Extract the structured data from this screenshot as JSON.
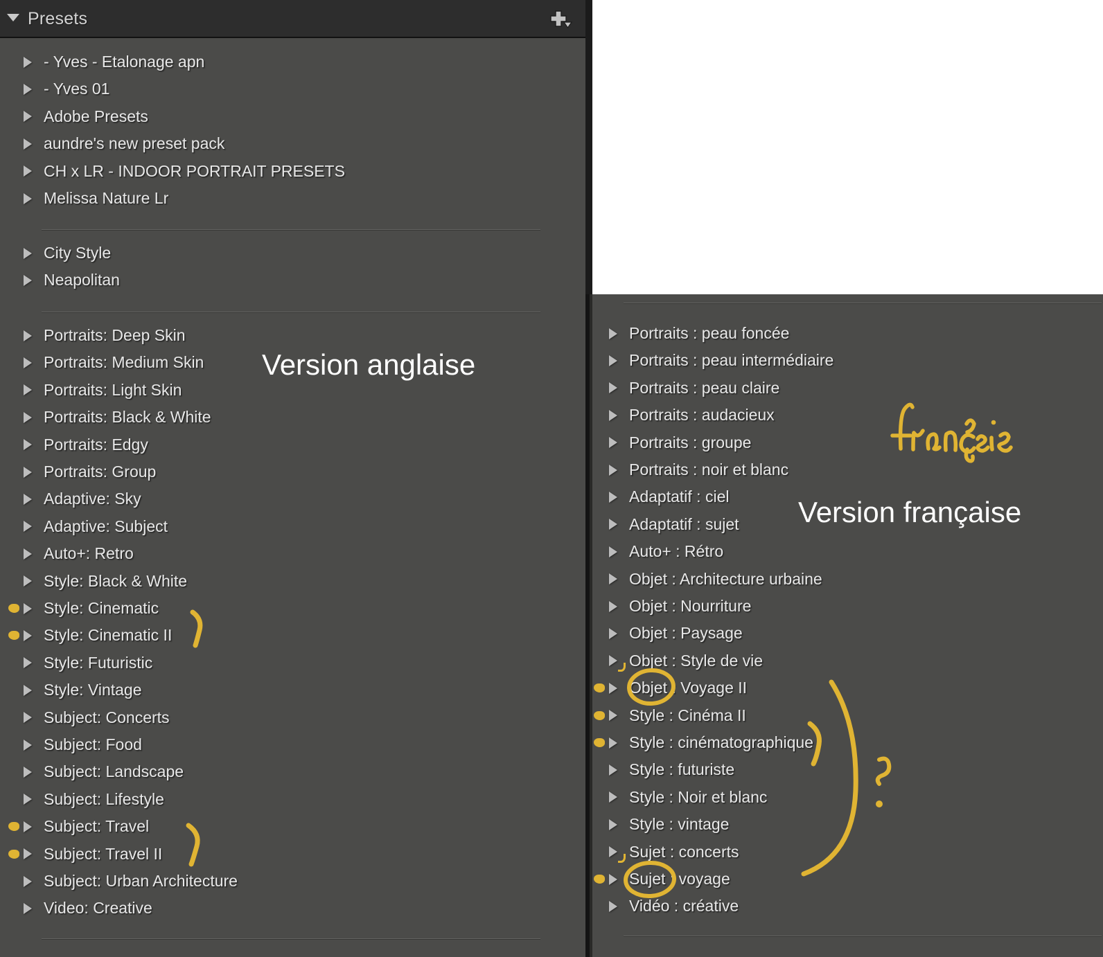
{
  "header": {
    "title": "Presets",
    "collapse_icon": "triangle-down-icon",
    "add_icon": "plus-with-chevron-icon"
  },
  "captions": {
    "english": "Version anglaise",
    "french": "Version française",
    "handwritten_french": "français"
  },
  "colors": {
    "panel_background": "#4b4b49",
    "header_background": "#2d2d2d",
    "text": "#e8e8e8",
    "annotation_yellow": "#e0b433",
    "separator": "#636361"
  },
  "english_panel": {
    "groups": [
      {
        "items": [
          {
            "label": "- Yves - Etalonage apn",
            "mark": ""
          },
          {
            "label": "- Yves 01",
            "mark": ""
          },
          {
            "label": "Adobe Presets",
            "mark": ""
          },
          {
            "label": "aundre's new preset pack",
            "mark": ""
          },
          {
            "label": "CH x LR - INDOOR PORTRAIT PRESETS",
            "mark": ""
          },
          {
            "label": "Melissa Nature Lr",
            "mark": ""
          }
        ]
      },
      {
        "items": [
          {
            "label": "City Style",
            "mark": ""
          },
          {
            "label": "Neapolitan",
            "mark": ""
          }
        ]
      },
      {
        "items": [
          {
            "label": "Portraits: Deep Skin",
            "mark": ""
          },
          {
            "label": "Portraits: Medium Skin",
            "mark": ""
          },
          {
            "label": "Portraits: Light Skin",
            "mark": ""
          },
          {
            "label": "Portraits: Black & White",
            "mark": ""
          },
          {
            "label": "Portraits: Edgy",
            "mark": ""
          },
          {
            "label": "Portraits: Group",
            "mark": ""
          },
          {
            "label": "Adaptive: Sky",
            "mark": ""
          },
          {
            "label": "Adaptive: Subject",
            "mark": ""
          },
          {
            "label": "Auto+: Retro",
            "mark": ""
          },
          {
            "label": "Style: Black & White",
            "mark": ""
          },
          {
            "label": "Style: Cinematic",
            "mark": "dot"
          },
          {
            "label": "Style: Cinematic II",
            "mark": "dot"
          },
          {
            "label": "Style: Futuristic",
            "mark": ""
          },
          {
            "label": "Style: Vintage",
            "mark": ""
          },
          {
            "label": "Subject: Concerts",
            "mark": ""
          },
          {
            "label": "Subject: Food",
            "mark": ""
          },
          {
            "label": "Subject: Landscape",
            "mark": ""
          },
          {
            "label": "Subject: Lifestyle",
            "mark": ""
          },
          {
            "label": "Subject: Travel",
            "mark": "dot"
          },
          {
            "label": "Subject: Travel II",
            "mark": "dot"
          },
          {
            "label": "Subject: Urban Architecture",
            "mark": ""
          },
          {
            "label": "Video: Creative",
            "mark": ""
          }
        ]
      }
    ]
  },
  "french_panel": {
    "items": [
      {
        "label": "Portraits : peau foncée",
        "mark": ""
      },
      {
        "label": "Portraits : peau intermédiaire",
        "mark": ""
      },
      {
        "label": "Portraits : peau claire",
        "mark": ""
      },
      {
        "label": "Portraits : audacieux",
        "mark": ""
      },
      {
        "label": "Portraits : groupe",
        "mark": ""
      },
      {
        "label": "Portraits : noir et blanc",
        "mark": ""
      },
      {
        "label": "Adaptatif : ciel",
        "mark": ""
      },
      {
        "label": "Adaptatif : sujet",
        "mark": ""
      },
      {
        "label": "Auto+ : Rétro",
        "mark": ""
      },
      {
        "label": "Objet : Architecture urbaine",
        "mark": ""
      },
      {
        "label": "Objet : Nourriture",
        "mark": ""
      },
      {
        "label": "Objet : Paysage",
        "mark": ""
      },
      {
        "label": "Objet : Style de vie",
        "mark": "tick"
      },
      {
        "label": "Objet : Voyage II",
        "mark": "dot-circle"
      },
      {
        "label": "Style : Cinéma II",
        "mark": "dot"
      },
      {
        "label": "Style : cinématographique",
        "mark": "dot"
      },
      {
        "label": "Style : futuriste",
        "mark": ""
      },
      {
        "label": "Style : Noir et blanc",
        "mark": ""
      },
      {
        "label": "Style : vintage",
        "mark": ""
      },
      {
        "label": "Sujet : concerts",
        "mark": "tick"
      },
      {
        "label": "Sujet : voyage",
        "mark": "dot-circle"
      },
      {
        "label": "Vidéo : créative",
        "mark": ""
      }
    ]
  },
  "annotations": {
    "english": [
      {
        "name": "brace-cinematic",
        "note": "bracket grouping Style: Cinematic and Style: Cinematic II"
      },
      {
        "name": "brace-travel",
        "note": "bracket grouping Subject: Travel and Subject: Travel II"
      }
    ],
    "french": [
      {
        "name": "circle-objet",
        "note": "circle around the word Objet"
      },
      {
        "name": "circle-sujet",
        "note": "circle around the word Sujet"
      },
      {
        "name": "brace-cinema",
        "note": "bracket grouping Style : Cinéma II and Style : cinématographique"
      },
      {
        "name": "brace-large",
        "note": "large bracket spanning Objet : Voyage II down to Sujet : voyage"
      },
      {
        "name": "question-mark",
        "note": "question mark"
      }
    ]
  }
}
